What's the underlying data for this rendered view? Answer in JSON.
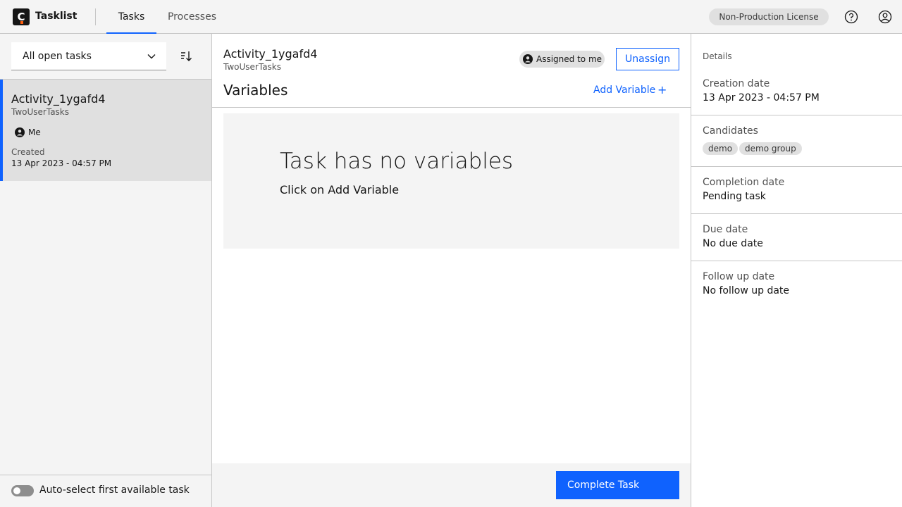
{
  "header": {
    "logo_letter": "C",
    "app_title": "Tasklist",
    "tabs": [
      {
        "label": "Tasks",
        "active": true
      },
      {
        "label": "Processes",
        "active": false
      }
    ],
    "license": "Non-Production License",
    "icons": [
      "help-icon",
      "user-profile-icon"
    ]
  },
  "left": {
    "filter_value": "All open tasks",
    "task": {
      "name": "Activity_1ygafd4",
      "process": "TwoUserTasks",
      "assignee": "Me",
      "created_label": "Created",
      "created_value": "13 Apr 2023 - 04:57 PM"
    },
    "auto_select_label": "Auto-select first available task",
    "auto_select_on": false
  },
  "main": {
    "task_name": "Activity_1ygafd4",
    "process_name": "TwoUserTasks",
    "assigned_tag": "Assigned to me",
    "unassign_label": "Unassign",
    "variables_title": "Variables",
    "add_variable_label": "Add Variable",
    "empty_title": "Task has no variables",
    "empty_subtitle": "Click on Add Variable",
    "complete_label": "Complete Task"
  },
  "details": {
    "header": "Details",
    "creation_label": "Creation date",
    "creation_value": "13 Apr 2023 - 04:57 PM",
    "candidates_label": "Candidates",
    "candidates": [
      "demo",
      "demo group"
    ],
    "completion_label": "Completion date",
    "completion_value": "Pending task",
    "due_label": "Due date",
    "due_value": "No due date",
    "followup_label": "Follow up date",
    "followup_value": "No follow up date"
  },
  "colors": {
    "accent": "#0f62fe",
    "panel_bg": "#f4f4f4",
    "selected_bg": "#e0e0e0"
  }
}
